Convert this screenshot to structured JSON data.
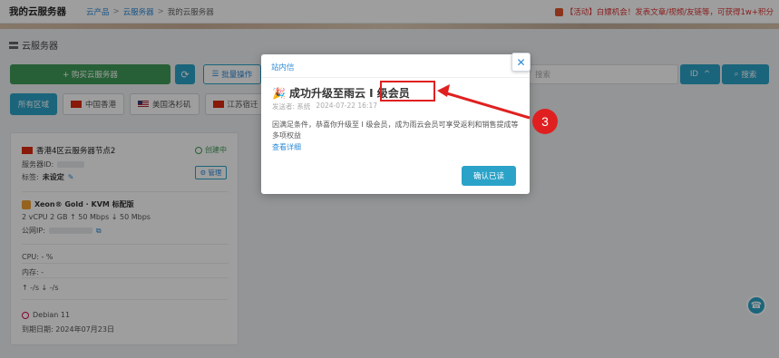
{
  "topbar": {
    "title": "我的云服务器",
    "breadcrumbs": [
      "云产品",
      "云服务器",
      "我的云服务器"
    ],
    "promo_text": "【活动】白嫖机会！发表文章/视频/友链等，可获得1w+积分"
  },
  "page": {
    "title": "云服务器"
  },
  "toolbar": {
    "buy_label": "+ 购买云服务器",
    "refresh_icon": "refresh-icon",
    "batch_label": "批量操作",
    "search_placeholder": "搜索",
    "id_label": "ID",
    "search_label": "搜索"
  },
  "regions": [
    {
      "label": "所有区域",
      "flag": "",
      "active": true
    },
    {
      "label": "中国香港",
      "flag": "hk",
      "active": false
    },
    {
      "label": "美国洛杉矶",
      "flag": "us",
      "active": false
    },
    {
      "label": "江苏宿迁",
      "flag": "cn",
      "active": false
    }
  ],
  "server": {
    "name": "香港4区云服务器节点2",
    "status": "创建中",
    "id_label": "服务器ID:",
    "tag_label": "标签:",
    "tag_value": "未设定",
    "manage_label": "管理",
    "cpu_model": "Xeon® Gold · KVM 标配版",
    "specs": "2 vCPU  2 GB  ↑ 50 Mbps  ↓ 50 Mbps",
    "ip_label": "公网IP:",
    "cpu_usage": "CPU: - %",
    "mem_usage": "内存: -",
    "traffic": "↑ -/s     ↓ -/s",
    "os": "Debian 11",
    "expire": "到期日期: 2024年07月23日"
  },
  "modal": {
    "header": "站内信",
    "title": "成功升级至雨云 I 级会员",
    "sender": "发送者: 系统",
    "date": "2024-07-22 16:17",
    "body": "因满足条件，恭喜你升级至 I 级会员，成为雨云会员可享受返利和销售提成等多项权益",
    "more_link": "查看详细",
    "confirm_label": "确认已读",
    "close_icon": "close-icon"
  },
  "annotation": {
    "step_number": "3",
    "color": "#e02020"
  },
  "colors": {
    "primary": "#2ba3c9",
    "success": "#3f9c58",
    "danger": "#e02020"
  }
}
